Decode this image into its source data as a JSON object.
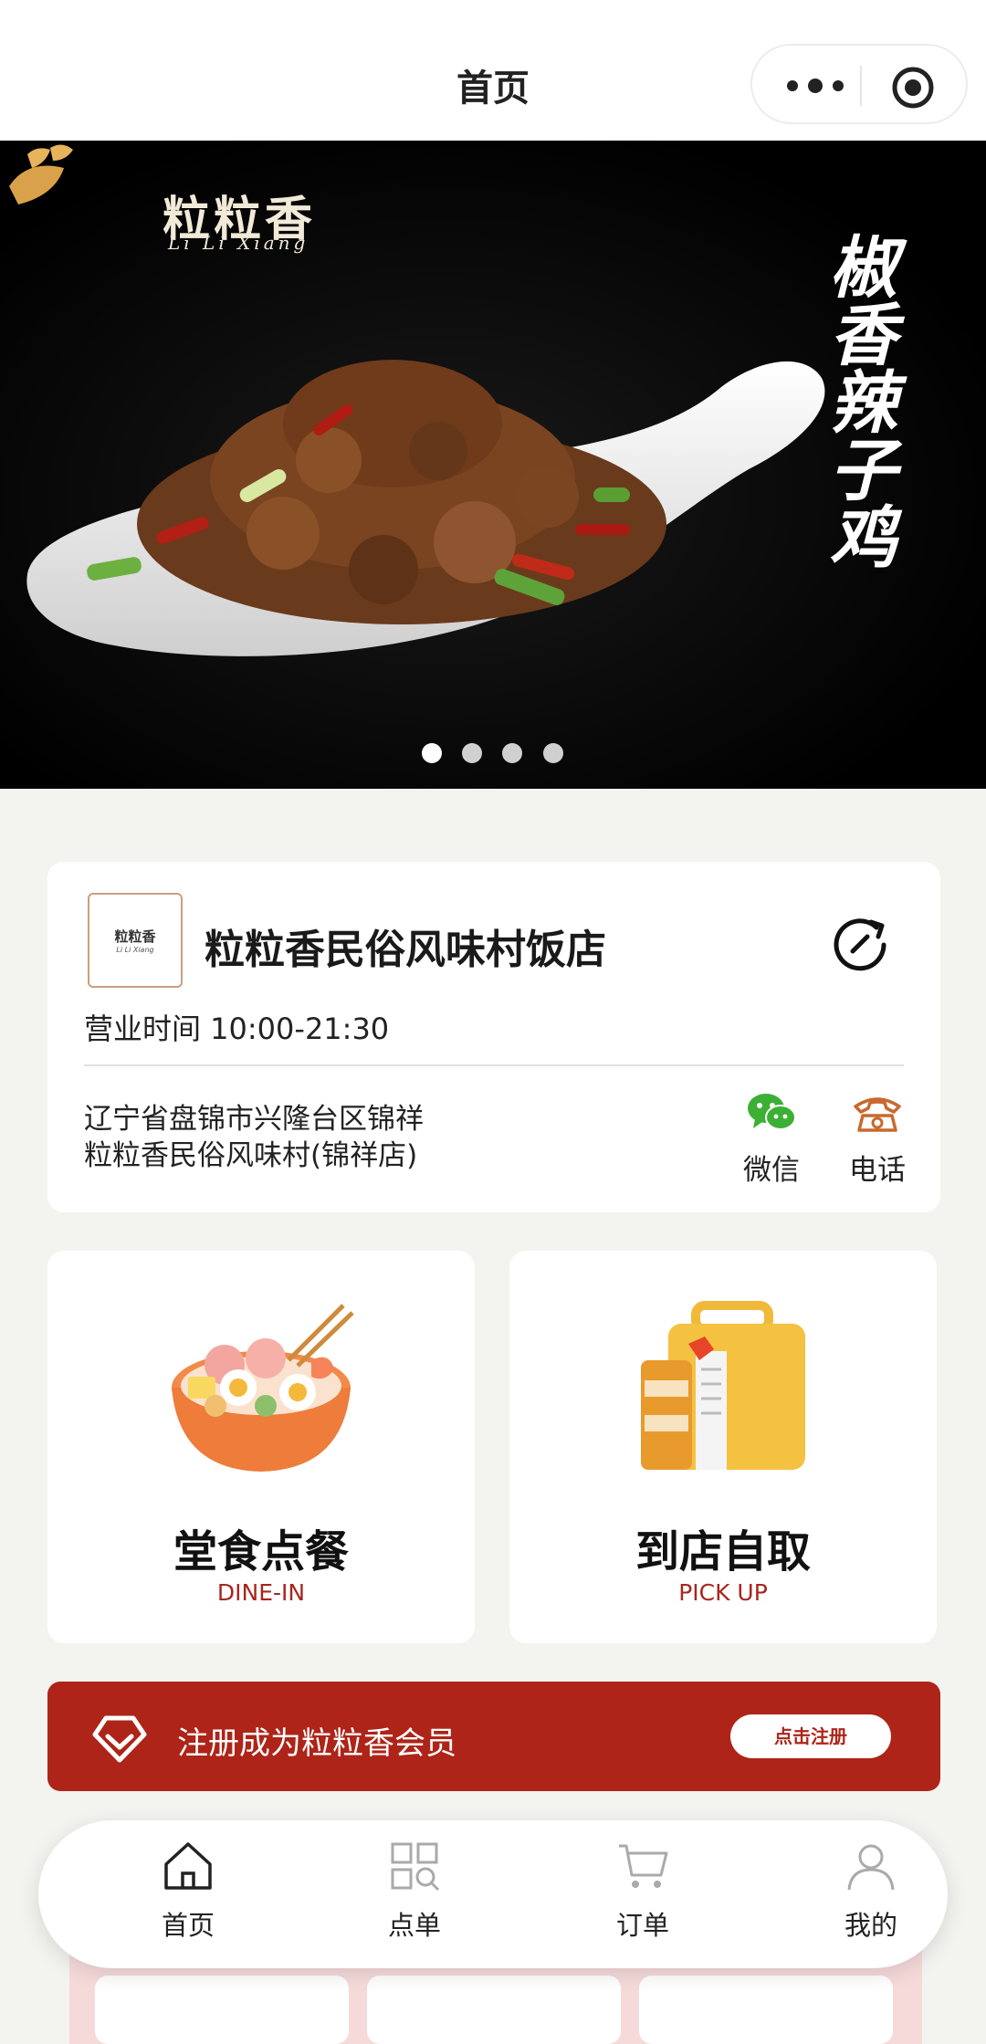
{
  "header": {
    "title": "首页"
  },
  "banner": {
    "logo_name": "粒粒香",
    "logo_sub": "Li Li Xiang",
    "dish_text": "椒香辣子鸡",
    "slides": 4,
    "active_slide": 1
  },
  "store": {
    "logo_top": "粒粒香",
    "logo_bottom": "Li Li Xiang",
    "name": "粒粒香民俗风味村饭店",
    "hours": "营业时间 10:00-21:30",
    "address_line1": "辽宁省盘锦市兴隆台区锦祥",
    "address_line2": "粒粒香民俗风味村(锦祥店)",
    "wechat_label": "微信",
    "phone_label": "电话"
  },
  "services": {
    "dine_in": {
      "title": "堂食点餐",
      "subtitle": "DINE-IN"
    },
    "pick_up": {
      "title": "到店自取",
      "subtitle": "PICK UP"
    }
  },
  "member": {
    "text": "注册成为粒粒香会员",
    "button": "点击注册"
  },
  "nav": {
    "home": "首页",
    "menu": "点单",
    "orders": "订单",
    "mine": "我的"
  },
  "colors": {
    "brand_red": "#ae2418",
    "page_bg": "#f3f3ef",
    "wechat_green": "#3cb034",
    "phone_orange": "#c8692e"
  },
  "icons": {
    "capsule_more": "more-dots-icon",
    "capsule_close": "target-icon",
    "store_action": "refresh-arrow-icon",
    "wechat": "wechat-icon",
    "phone": "telephone-icon",
    "member": "diamond-icon",
    "nav_home": "home-icon",
    "nav_menu": "grid-search-icon",
    "nav_orders": "cart-icon",
    "nav_mine": "user-icon"
  }
}
